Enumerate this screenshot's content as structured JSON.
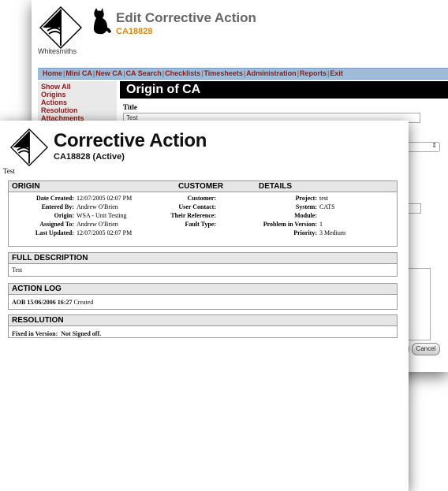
{
  "back": {
    "logo_text": "Whitesmiths",
    "title": "Edit Corrective Action",
    "ca_id": "CA18828",
    "nav": [
      "Home",
      "Mini CA",
      "New CA",
      "CA Search",
      "Checklists",
      "Timesheets",
      "Administration",
      "Reports",
      "Exit"
    ],
    "side": [
      "Show All",
      "Origins",
      "Actions",
      "Resolution",
      "Attachments"
    ],
    "section_title": "Origin of CA",
    "field_label": "Title",
    "field_value": "Test",
    "cancel_label": "Cancel"
  },
  "report": {
    "title": "Corrective Action",
    "subtitle": "CA18828 (Active)",
    "desc": "Test",
    "origin": {
      "headers": [
        "ORIGIN",
        "CUSTOMER",
        "DETAILS"
      ],
      "col1": [
        {
          "label": "Date Created:",
          "value": "12/07/2005 02:07 PM"
        },
        {
          "label": "Entered By:",
          "value": "Andrew O'Brien"
        },
        {
          "label": "Origin:",
          "value": "WSA - Unit Testing"
        },
        {
          "label": "Assigned To:",
          "value": "Andrew O'Brien"
        },
        {
          "label": "Last Updated:",
          "value": "12/07/2005 02:07 PM"
        }
      ],
      "col2": [
        {
          "label": "Customer:",
          "value": ""
        },
        {
          "label": "User Contact:",
          "value": ""
        },
        {
          "label": "Their Reference:",
          "value": ""
        },
        {
          "label": "Fault Type:",
          "value": ""
        }
      ],
      "col3": [
        {
          "label": "Project:",
          "value": "test"
        },
        {
          "label": "System:",
          "value": "CATS"
        },
        {
          "label": "Module:",
          "value": ""
        },
        {
          "label": "Problem in Version:",
          "value": "1"
        },
        {
          "label": "Priority:",
          "value": "3 Medium"
        }
      ]
    },
    "full_description": {
      "header": "FULL DESCRIPTION",
      "text": "Test"
    },
    "action_log": {
      "header": "ACTION LOG",
      "entry_bold": "AOB 15/06/2006 16:27",
      "entry_text": "Created"
    },
    "resolution": {
      "header": "RESOLUTION",
      "label": "Fixed in Version:",
      "value": "Not Signed off."
    }
  }
}
